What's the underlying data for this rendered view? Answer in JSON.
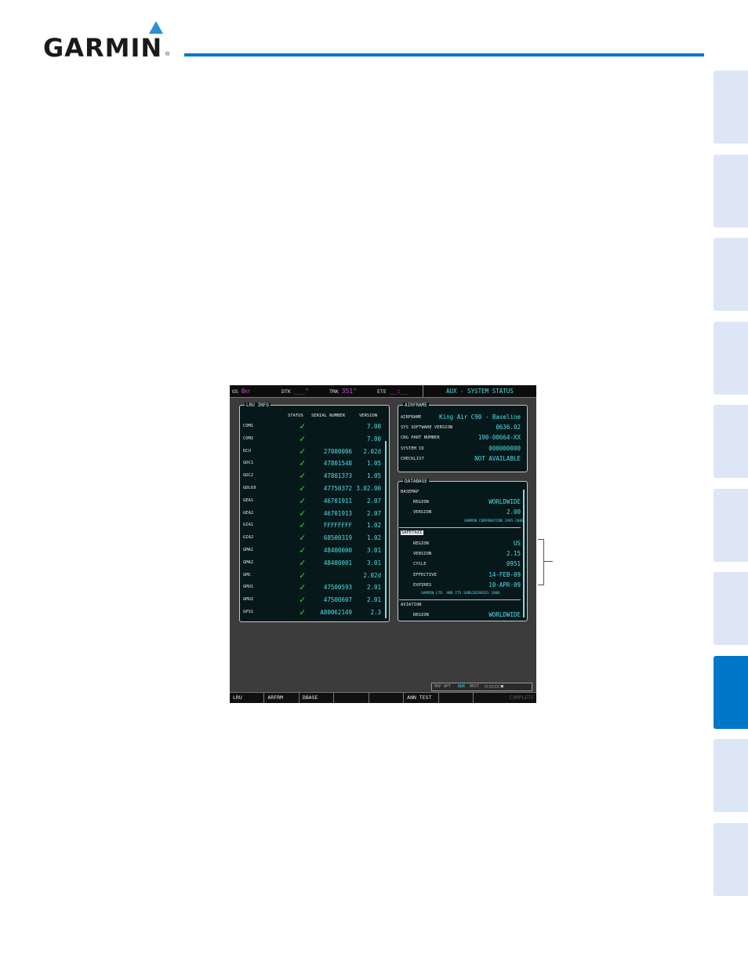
{
  "brand": {
    "name": "GARMIN",
    "reg": "®",
    "accent": "#0077c8"
  },
  "side_tabs": {
    "count": 10,
    "active_index": 7
  },
  "screen": {
    "topbar": {
      "gs_label": "GS",
      "gs_value": "0",
      "gs_unit": "KT",
      "dtk_label": "DTK",
      "dtk_value": "___°",
      "trk_label": "TRK",
      "trk_value": "351°",
      "ete_label": "ETE",
      "ete_value": "__:__",
      "page_title": "AUX - SYSTEM STATUS"
    },
    "lru": {
      "label": "LRU INFO",
      "headers": {
        "status": "STATUS",
        "serial": "SERIAL NUMBER",
        "version": "VERSION"
      },
      "rows": [
        {
          "name": "COM1",
          "serial": "",
          "version": "7.00"
        },
        {
          "name": "COM2",
          "serial": "",
          "version": "7.00"
        },
        {
          "name": "DCU",
          "serial": "27000006",
          "version": "2.02d"
        },
        {
          "name": "GDC1",
          "serial": "47801548",
          "version": "1.05"
        },
        {
          "name": "GDC2",
          "serial": "47801373",
          "version": "1.05"
        },
        {
          "name": "GDL69",
          "serial": "47750372",
          "version": "3.02.00"
        },
        {
          "name": "GEA1",
          "serial": "46701911",
          "version": "2.07"
        },
        {
          "name": "GEA2",
          "serial": "46701913",
          "version": "2.07"
        },
        {
          "name": "GIA1",
          "serial": "FFFFFFFF",
          "version": "1.02"
        },
        {
          "name": "GIA2",
          "serial": "68500319",
          "version": "1.02"
        },
        {
          "name": "GMA1",
          "serial": "48400000",
          "version": "3.01"
        },
        {
          "name": "GMA2",
          "serial": "48400001",
          "version": "3.01"
        },
        {
          "name": "GMC",
          "serial": "",
          "version": "2.02d"
        },
        {
          "name": "GMU1",
          "serial": "47500593",
          "version": "2.01"
        },
        {
          "name": "GMU2",
          "serial": "47500607",
          "version": "2.01"
        },
        {
          "name": "GPS1",
          "serial": "A80062149",
          "version": "2.3"
        }
      ]
    },
    "airframe": {
      "label": "AIRFRAME",
      "rows": [
        {
          "label": "AIRFRAME",
          "value": "King Air C90 - Baseline"
        },
        {
          "label": "SYS SOFTWARE VERSION",
          "value": "0636.02"
        },
        {
          "label": "CRG PART NUMBER",
          "value": "190-00664-XX"
        },
        {
          "label": "SYSTEM ID",
          "value": "000000000"
        },
        {
          "label": "CHECKLIST",
          "value": "NOT AVAILABLE"
        }
      ]
    },
    "database": {
      "label": "DATABASE",
      "basemap": {
        "title": "BASEMAP",
        "region_label": "REGION",
        "region_value": "WORLDWIDE",
        "version_label": "VERSION",
        "version_value": "2.00",
        "copyright": "GARMIN CORPORATION 1995-2009"
      },
      "safetaxi": {
        "title": "SAFETAXI",
        "rows": [
          {
            "label": "REGION",
            "value": "US"
          },
          {
            "label": "VERSION",
            "value": "2.15"
          },
          {
            "label": "CYCLE",
            "value": "0951"
          },
          {
            "label": "EFFECTIVE",
            "value": "14-FEB-09"
          },
          {
            "label": "EXPIRES",
            "value": "10-APR-09"
          }
        ],
        "copyright": "GARMIN LTD. AND ITS SUBSIDIARIES 2008"
      },
      "aviation": {
        "title": "AVIATION",
        "region_label": "REGION",
        "region_value": "WORLDWIDE"
      }
    },
    "nav_status": {
      "groups": "MAP WPT",
      "active": "AUX",
      "nrst": "NRST",
      "boxes": "□□□□□□■"
    },
    "softkeys": [
      "LRU",
      "ARFRM",
      "DBASE",
      "",
      "",
      "ANN TEST",
      "",
      "COMPLETE"
    ]
  }
}
